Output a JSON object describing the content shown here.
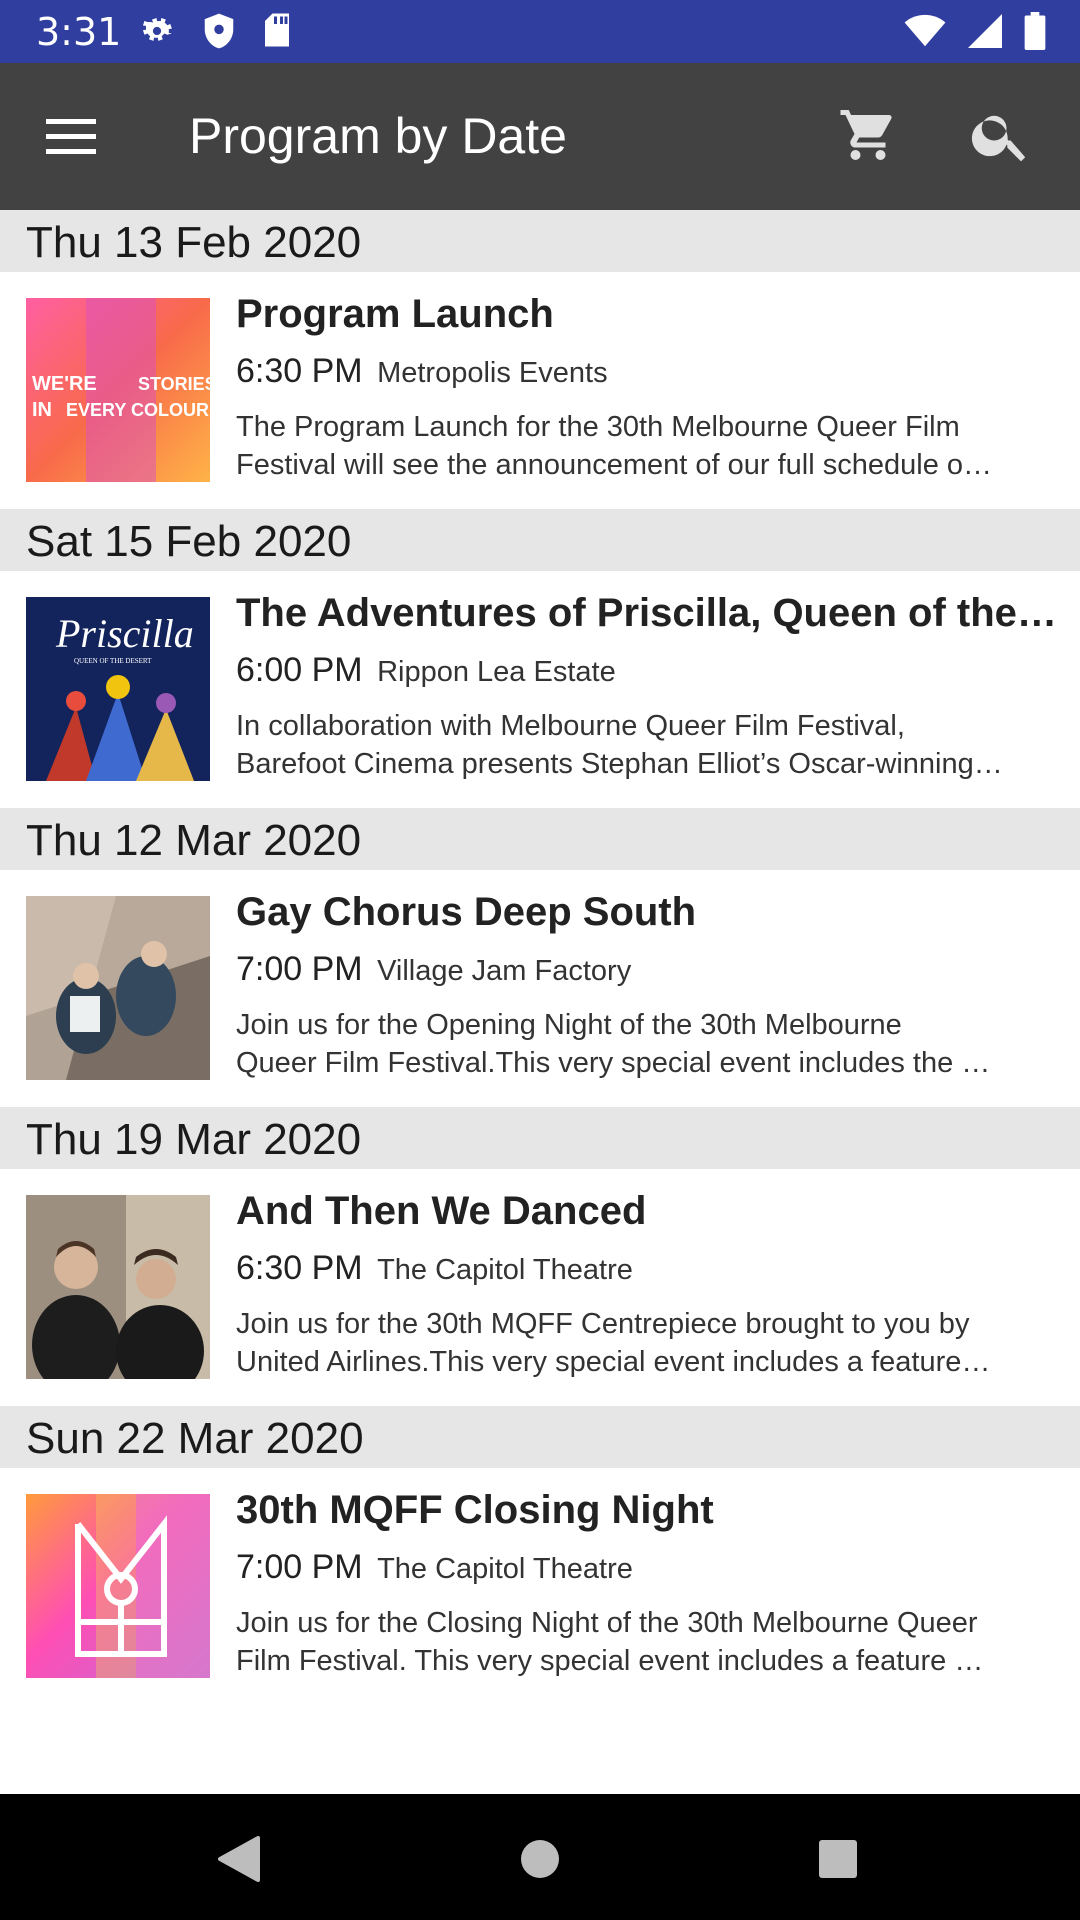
{
  "status_bar": {
    "time": "3:31",
    "icons_left": [
      "gear-icon",
      "shield-icon",
      "sd-card-icon"
    ],
    "icons_right": [
      "wifi-icon",
      "signal-icon",
      "battery-icon"
    ]
  },
  "toolbar": {
    "title": "Program by Date",
    "menu_icon": "menu-icon",
    "cart_icon": "cart-icon",
    "search_icon": "search-icon",
    "background": "#424242"
  },
  "colors": {
    "status_bar": "#303f9f",
    "date_header": "#e6e6e6"
  },
  "program": [
    {
      "date": "Thu 13 Feb 2020",
      "event": {
        "title": "Program Launch",
        "time": "6:30 PM",
        "venue": "Metropolis Events",
        "desc_line1": "The Program Launch for the 30th Melbourne Queer Film",
        "desc_line2": "Festival will see the announcement of our full schedule o…",
        "poster_text_1": "WE'RE",
        "poster_text_2": "STORIES",
        "poster_text_3": "IN",
        "poster_text_4": "EVERY COLOUR"
      }
    },
    {
      "date": "Sat 15 Feb 2020",
      "event": {
        "title": "The Adventures of Priscilla, Queen of the …",
        "time": "6:00 PM",
        "venue": "Rippon Lea Estate",
        "desc_line1": "In collaboration with Melbourne Queer Film Festival,",
        "desc_line2": "Barefoot Cinema presents Stephan Elliot’s Oscar-winning…",
        "poster_text_1": "Priscilla",
        "poster_text_2": "QUEEN OF THE DESERT"
      }
    },
    {
      "date": "Thu 12 Mar 2020",
      "event": {
        "title": "Gay Chorus Deep South",
        "time": "7:00 PM",
        "venue": "Village Jam Factory",
        "desc_line1": "Join us for the Opening Night of the 30th Melbourne",
        "desc_line2": "Queer Film Festival.This very special event includes the …"
      }
    },
    {
      "date": "Thu 19 Mar 2020",
      "event": {
        "title": "And Then We Danced",
        "time": "6:30 PM",
        "venue": "The Capitol Theatre",
        "desc_line1": "Join us for the 30th MQFF Centrepiece brought to you by",
        "desc_line2": "United Airlines.This very special event includes a feature…"
      }
    },
    {
      "date": "Sun 22 Mar 2020",
      "event": {
        "title": "30th MQFF Closing Night",
        "time": "7:00 PM",
        "venue": "The Capitol Theatre",
        "desc_line1": "Join us for the Closing Night of the 30th Melbourne Queer",
        "desc_line2": "Film Festival. This very special event includes a feature …"
      }
    }
  ],
  "nav_bar": {
    "back_icon": "back-triangle-icon",
    "home_icon": "home-circle-icon",
    "recents_icon": "recents-square-icon"
  }
}
